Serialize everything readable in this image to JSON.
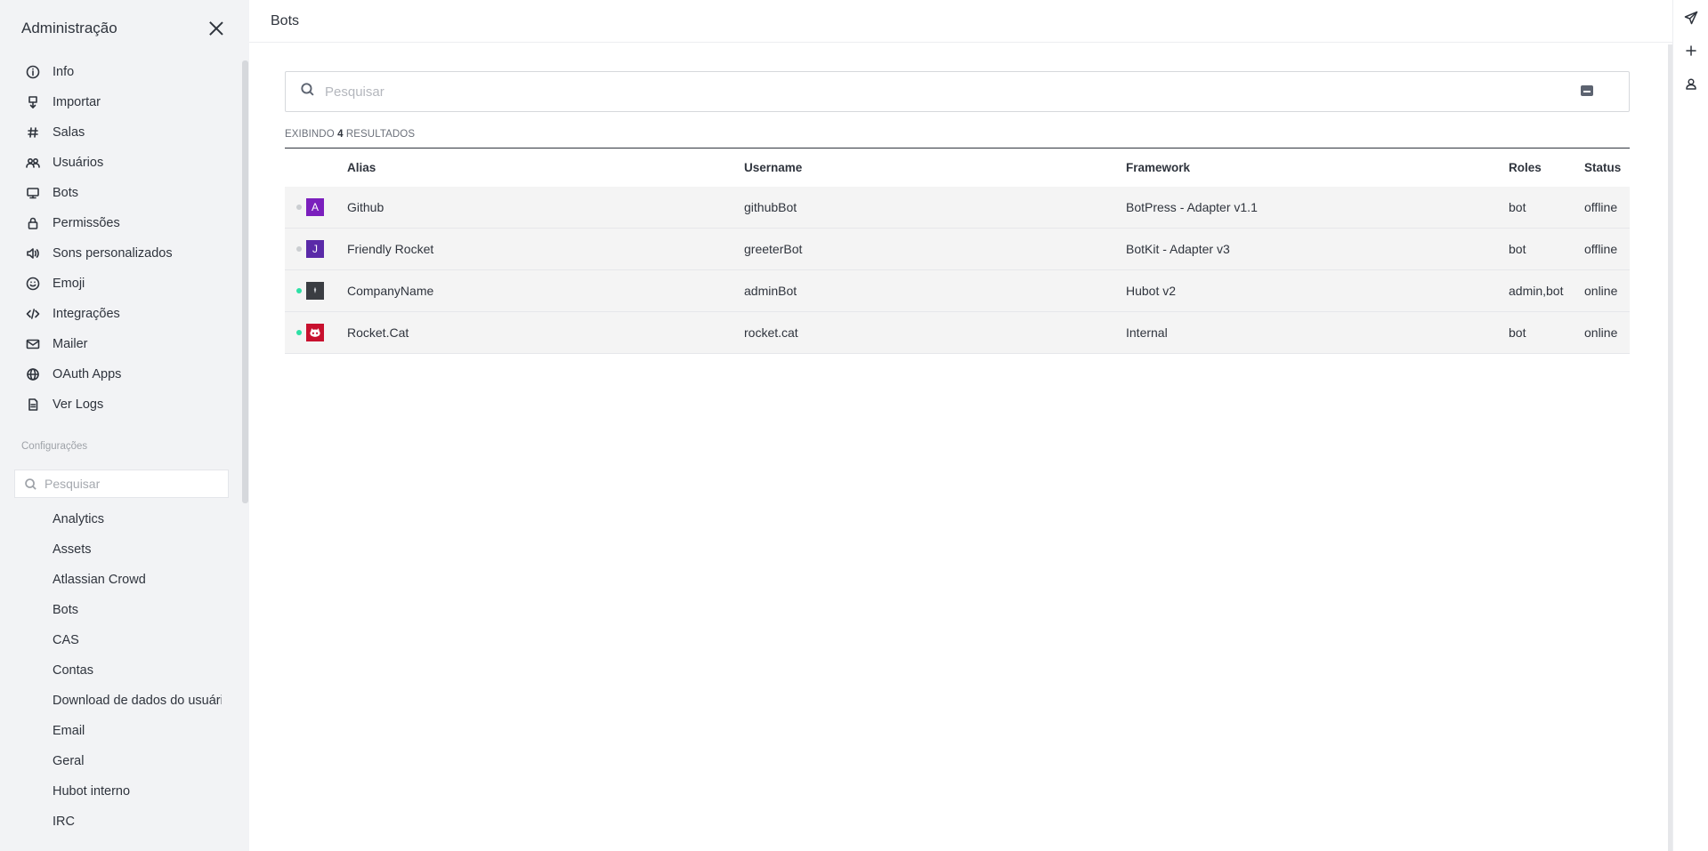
{
  "sidebar": {
    "title": "Administração",
    "items": [
      {
        "label": "Info",
        "icon": "info-icon"
      },
      {
        "label": "Importar",
        "icon": "import-icon"
      },
      {
        "label": "Salas",
        "icon": "hashtag-icon"
      },
      {
        "label": "Usuários",
        "icon": "team-icon"
      },
      {
        "label": "Bots",
        "icon": "computer-icon"
      },
      {
        "label": "Permissões",
        "icon": "lock-icon"
      },
      {
        "label": "Sons personalizados",
        "icon": "volume-icon"
      },
      {
        "label": "Emoji",
        "icon": "emoji-icon"
      },
      {
        "label": "Integrações",
        "icon": "code-icon"
      },
      {
        "label": "Mailer",
        "icon": "mail-icon"
      },
      {
        "label": "OAuth Apps",
        "icon": "globe-icon"
      },
      {
        "label": "Ver Logs",
        "icon": "file-icon"
      }
    ],
    "settings_section": "Configurações",
    "settings_search_placeholder": "Pesquisar",
    "settings_items": [
      "Analytics",
      "Assets",
      "Atlassian Crowd",
      "Bots",
      "CAS",
      "Contas",
      "Download de dados do usuário",
      "Email",
      "Geral",
      "Hubot interno",
      "IRC"
    ]
  },
  "main": {
    "title": "Bots",
    "search_placeholder": "Pesquisar",
    "result_prefix": "EXIBINDO",
    "result_count": "4",
    "result_suffix": "RESULTADOS",
    "columns": {
      "alias": "Alias",
      "username": "Username",
      "framework": "Framework",
      "roles": "Roles",
      "status": "Status"
    },
    "rows": [
      {
        "alias": "Github",
        "username": "githubBot",
        "framework": "BotPress - Adapter v1.1",
        "roles": "bot",
        "status": "offline",
        "avatar_letter": "A",
        "avatar_color": "#7b1fbd",
        "dot_color": "#cbced1"
      },
      {
        "alias": "Friendly Rocket",
        "username": "greeterBot",
        "framework": "BotKit - Adapter v3",
        "roles": "bot",
        "status": "offline",
        "avatar_letter": "J",
        "avatar_color": "#5a2aa8",
        "dot_color": "#cbced1"
      },
      {
        "alias": "CompanyName",
        "username": "adminBot",
        "framework": "Hubot v2",
        "roles": "admin,bot",
        "status": "online",
        "avatar_letter": "",
        "avatar_color": "#3a3d42",
        "dot_color": "#2de0a5"
      },
      {
        "alias": "Rocket.Cat",
        "username": "rocket.cat",
        "framework": "Internal",
        "roles": "bot",
        "status": "online",
        "avatar_letter": "",
        "avatar_color": "#c8102e",
        "dot_color": "#2de0a5"
      }
    ]
  },
  "rail": {
    "icons": [
      "send-icon",
      "plus-icon",
      "user-icon"
    ]
  }
}
